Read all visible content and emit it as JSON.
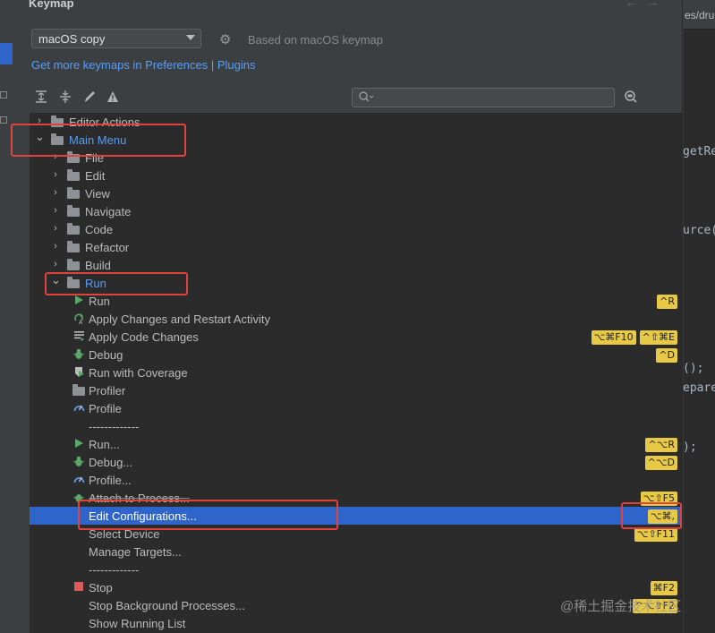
{
  "dialog": {
    "title": "Keymap",
    "nav_back": "←",
    "nav_forward": "→",
    "keymap_select": "macOS copy",
    "based_on": "Based on macOS keymap",
    "links_text": "Get more keymaps in Preferences | Plugins",
    "search_placeholder": ""
  },
  "toolbar": {
    "expand_all_icon": "expand-all-icon",
    "collapse_all_icon": "collapse-all-icon",
    "edit_icon": "pencil-icon",
    "warning_icon": "warning-icon",
    "find_by_shortcut_icon": "find-shortcut-icon"
  },
  "colors": {
    "accent": "#2f65ca",
    "link": "#589df6",
    "shortcut_badge": "#e8c946",
    "highlight_box": "#e0423d"
  },
  "tree": [
    {
      "label": "Editor Actions",
      "level": 0,
      "type": "folder",
      "expanded": false,
      "shortcuts": []
    },
    {
      "label": "Main Menu",
      "level": 0,
      "type": "folder",
      "expanded": true,
      "shortcuts": [],
      "blue": true
    },
    {
      "label": "File",
      "level": 1,
      "type": "folder",
      "expanded": false,
      "shortcuts": []
    },
    {
      "label": "Edit",
      "level": 1,
      "type": "folder",
      "expanded": false,
      "shortcuts": []
    },
    {
      "label": "View",
      "level": 1,
      "type": "folder",
      "expanded": false,
      "shortcuts": []
    },
    {
      "label": "Navigate",
      "level": 1,
      "type": "folder",
      "expanded": false,
      "shortcuts": []
    },
    {
      "label": "Code",
      "level": 1,
      "type": "folder",
      "expanded": false,
      "shortcuts": []
    },
    {
      "label": "Refactor",
      "level": 1,
      "type": "folder",
      "expanded": false,
      "shortcuts": []
    },
    {
      "label": "Build",
      "level": 1,
      "type": "folder",
      "expanded": false,
      "shortcuts": []
    },
    {
      "label": "Run",
      "level": 1,
      "type": "folder",
      "expanded": true,
      "shortcuts": [],
      "blue": true
    },
    {
      "label": "Run",
      "level": 2,
      "type": "action",
      "icon": "run",
      "shortcuts": [
        "^R"
      ]
    },
    {
      "label": "Apply Changes and Restart Activity",
      "level": 2,
      "type": "action",
      "icon": "apply-restart",
      "shortcuts": []
    },
    {
      "label": "Apply Code Changes",
      "level": 2,
      "type": "action",
      "icon": "apply-code",
      "shortcuts": [
        "⌥⌘F10",
        "^⇧⌘E"
      ]
    },
    {
      "label": "Debug",
      "level": 2,
      "type": "action",
      "icon": "debug",
      "shortcuts": [
        "^D"
      ]
    },
    {
      "label": "Run with Coverage",
      "level": 2,
      "type": "action",
      "icon": "coverage",
      "shortcuts": []
    },
    {
      "label": "Profiler",
      "level": 2,
      "type": "folder",
      "shortcuts": []
    },
    {
      "label": "Profile",
      "level": 2,
      "type": "action",
      "icon": "profile",
      "shortcuts": []
    },
    {
      "label": "-------------",
      "level": 2,
      "type": "separator",
      "shortcuts": []
    },
    {
      "label": "Run...",
      "level": 2,
      "type": "action",
      "icon": "run",
      "shortcuts": [
        "^⌥R"
      ]
    },
    {
      "label": "Debug...",
      "level": 2,
      "type": "action",
      "icon": "debug",
      "shortcuts": [
        "^⌥D"
      ]
    },
    {
      "label": "Profile...",
      "level": 2,
      "type": "action",
      "icon": "profile",
      "shortcuts": []
    },
    {
      "label": "Attach to Process...",
      "level": 2,
      "type": "action",
      "icon": "attach",
      "shortcuts": [
        "⌥⇧F5"
      ],
      "strike": true
    },
    {
      "label": "Edit Configurations...",
      "level": 2,
      "type": "action",
      "icon": "none",
      "shortcuts": [
        "⌥⌘,"
      ],
      "selected": true
    },
    {
      "label": "Select Device",
      "level": 2,
      "type": "action",
      "icon": "none",
      "shortcuts": [
        "⌥⇧F11"
      ]
    },
    {
      "label": "Manage Targets...",
      "level": 2,
      "type": "action",
      "icon": "none",
      "shortcuts": []
    },
    {
      "label": "-------------",
      "level": 2,
      "type": "separator",
      "shortcuts": []
    },
    {
      "label": "Stop",
      "level": 2,
      "type": "action",
      "icon": "stop",
      "shortcuts": [
        "⌘F2"
      ]
    },
    {
      "label": "Stop Background Processes...",
      "level": 2,
      "type": "action",
      "icon": "none",
      "shortcuts": [
        "^⌥⇧F2"
      ]
    },
    {
      "label": "Show Running List",
      "level": 2,
      "type": "action",
      "icon": "none",
      "shortcuts": []
    }
  ],
  "editor": {
    "tab_path": "es/druid",
    "lines": [
      {
        "text": "getRe",
        "row": 170
      },
      {
        "text": "urce(",
        "row": 258
      },
      {
        "text": "();",
        "row": 412
      },
      {
        "text": "epare",
        "row": 434
      },
      {
        "text": ");",
        "row": 500
      }
    ]
  },
  "watermark": "@稀土掘金技术社区"
}
